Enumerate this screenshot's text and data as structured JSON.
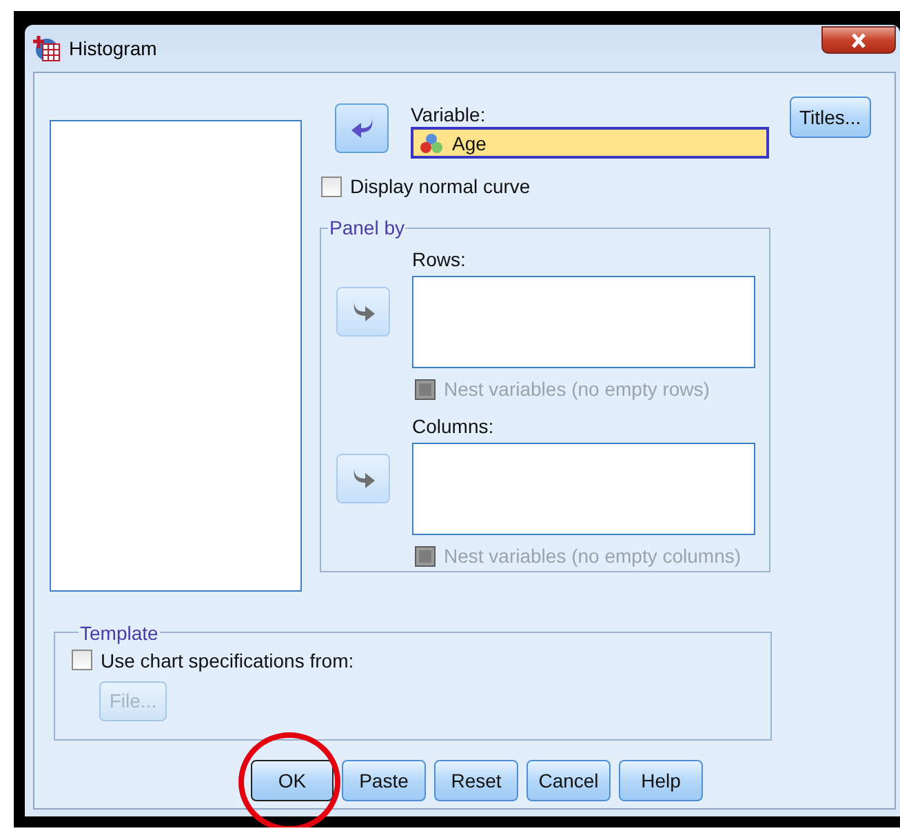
{
  "window": {
    "title": "Histogram"
  },
  "variable": {
    "label": "Variable:",
    "value": "Age",
    "move_button": {
      "disabled": false
    }
  },
  "titles_button": {
    "label": "Titles..."
  },
  "display_normal_curve": {
    "label": "Display normal curve",
    "checked": false
  },
  "panel_by": {
    "title": "Panel by",
    "rows": {
      "label": "Rows:",
      "move_button": {
        "disabled": true
      },
      "nest": {
        "label": "Nest variables (no empty rows)",
        "checked": false,
        "disabled": true
      }
    },
    "columns": {
      "label": "Columns:",
      "move_button": {
        "disabled": true
      },
      "nest": {
        "label": "Nest variables (no empty columns)",
        "checked": false,
        "disabled": true
      }
    }
  },
  "template": {
    "title": "Template",
    "use_spec": {
      "label": "Use chart specifications from:",
      "checked": false
    },
    "file_button": {
      "label": "File...",
      "disabled": true
    }
  },
  "buttons": [
    {
      "label": "OK",
      "circled": true
    },
    {
      "label": "Paste",
      "circled": false
    },
    {
      "label": "Reset",
      "circled": false
    },
    {
      "label": "Cancel",
      "circled": false
    },
    {
      "label": "Help",
      "circled": false
    }
  ]
}
